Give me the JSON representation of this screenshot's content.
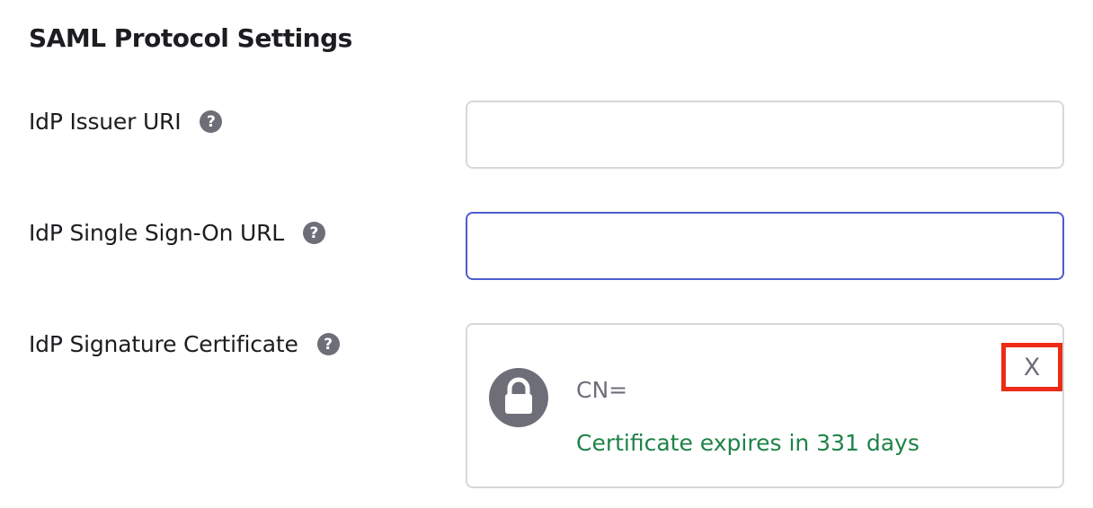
{
  "section": {
    "title": "SAML Protocol Settings"
  },
  "fields": {
    "issuer_uri": {
      "label": "IdP Issuer URI",
      "value": "",
      "help_icon": "question-circle-icon"
    },
    "sso_url": {
      "label": "IdP Single Sign-On URL",
      "value": "",
      "help_icon": "question-circle-icon",
      "state": "focused"
    },
    "signature_certificate": {
      "label": "IdP Signature Certificate",
      "help_icon": "question-circle-icon"
    }
  },
  "certificate": {
    "icon": "lock-icon",
    "cn": "CN=",
    "expiry": "Certificate expires in 331 days",
    "remove_label": "X"
  },
  "help_glyph": "?",
  "colors": {
    "focus_border": "#4d5ccf",
    "expiry_text": "#1e8348",
    "highlight_box": "#ee2c16",
    "icon_gray": "#6e6e78"
  }
}
